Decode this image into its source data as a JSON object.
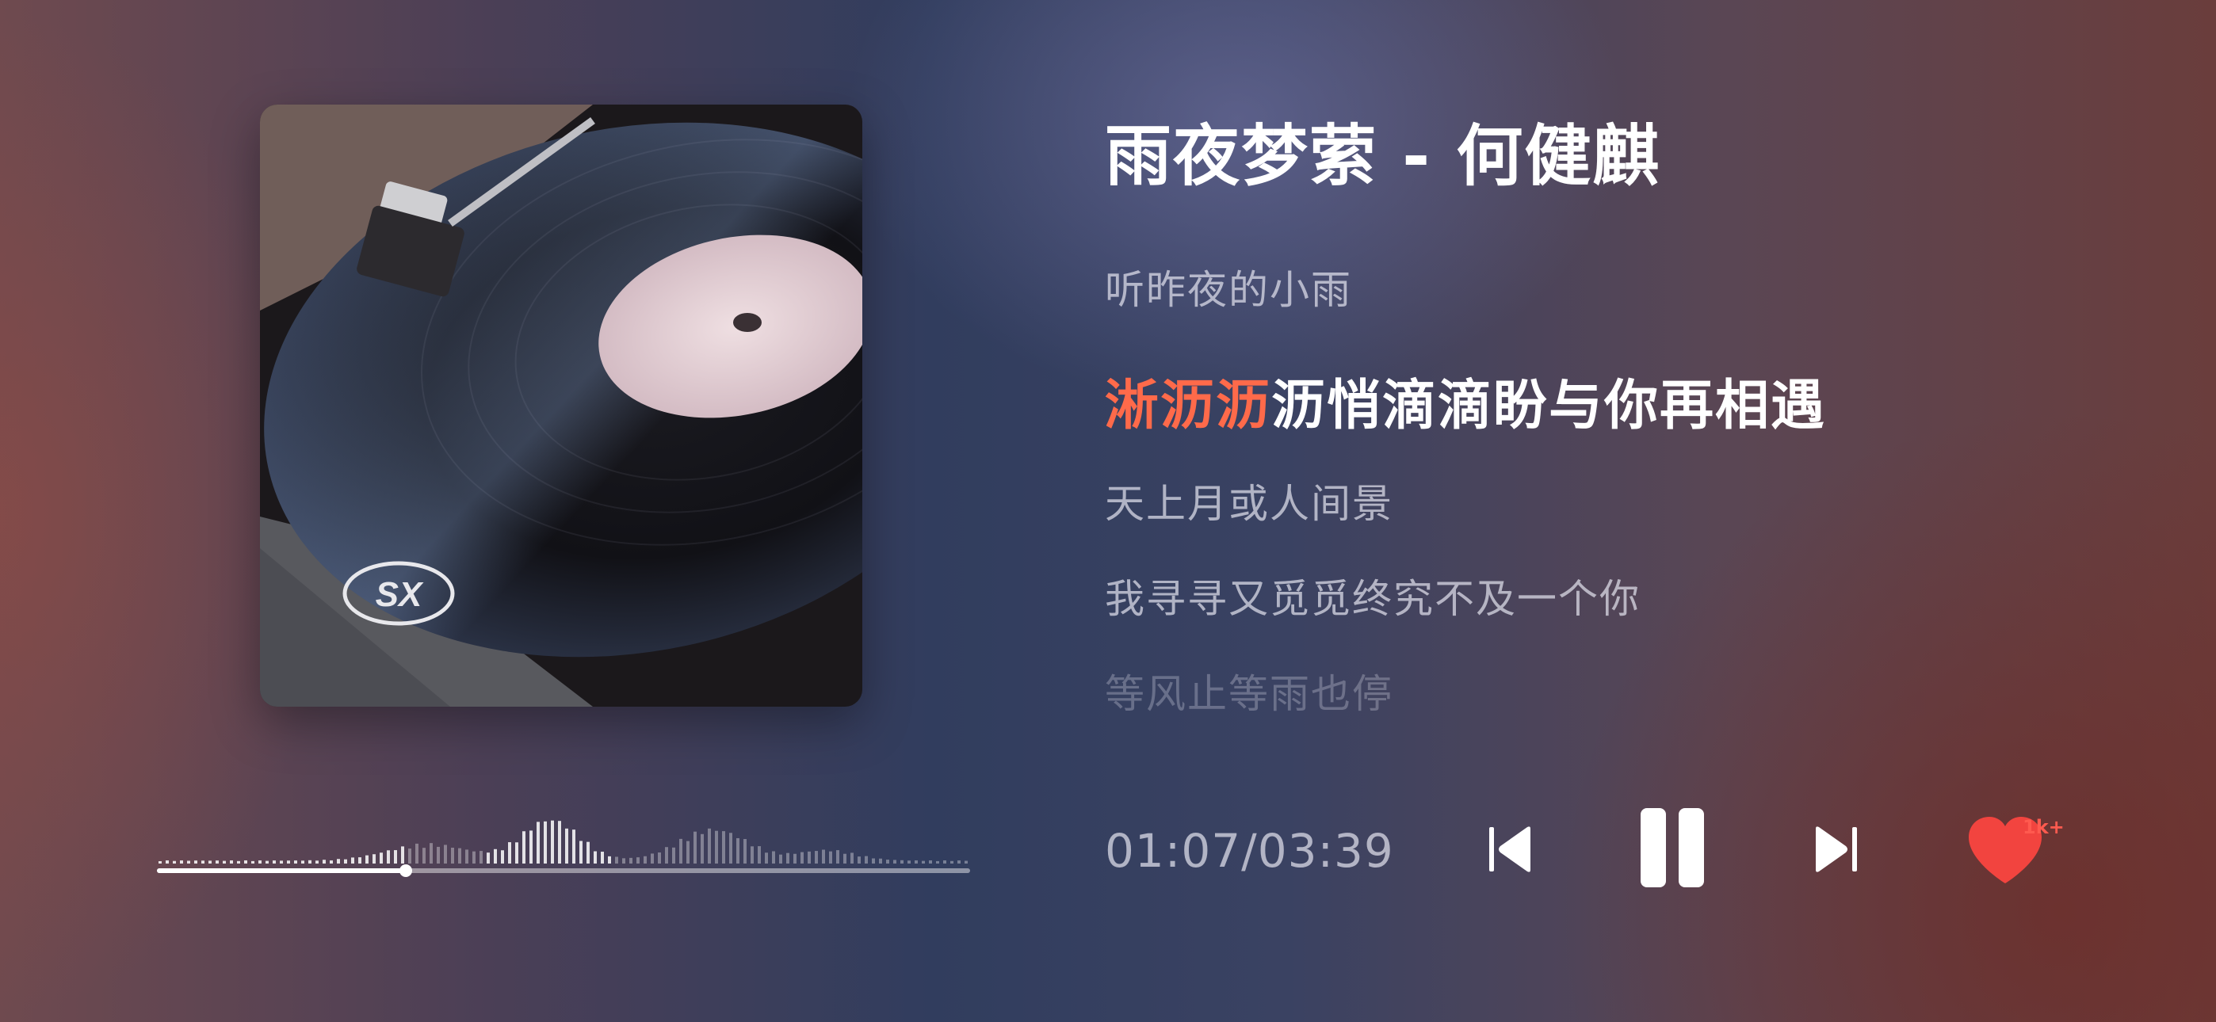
{
  "song": {
    "title": "雨夜梦萦 - 何健麒"
  },
  "album": {
    "logo_text": "SX"
  },
  "lyrics": {
    "previous": "听昨夜的小雨",
    "current_sung": "淅沥沥",
    "current_rest": "沥悄滴滴盼与你再相遇",
    "next_1": "天上月或人间景",
    "next_2": "我寻寻又觅觅终究不及一个你",
    "next_3": "等风止等雨也停"
  },
  "playback": {
    "time_display": "01:07/03:39",
    "elapsed_seconds": 67,
    "total_seconds": 219,
    "state": "playing"
  },
  "controls": {
    "prev_icon": "skip-previous-icon",
    "pause_icon": "pause-icon",
    "next_icon": "skip-next-icon",
    "like_icon": "heart-icon",
    "like_count": "1k+"
  },
  "colors": {
    "accent": "#ff6a4a",
    "like": "#f2443f"
  }
}
